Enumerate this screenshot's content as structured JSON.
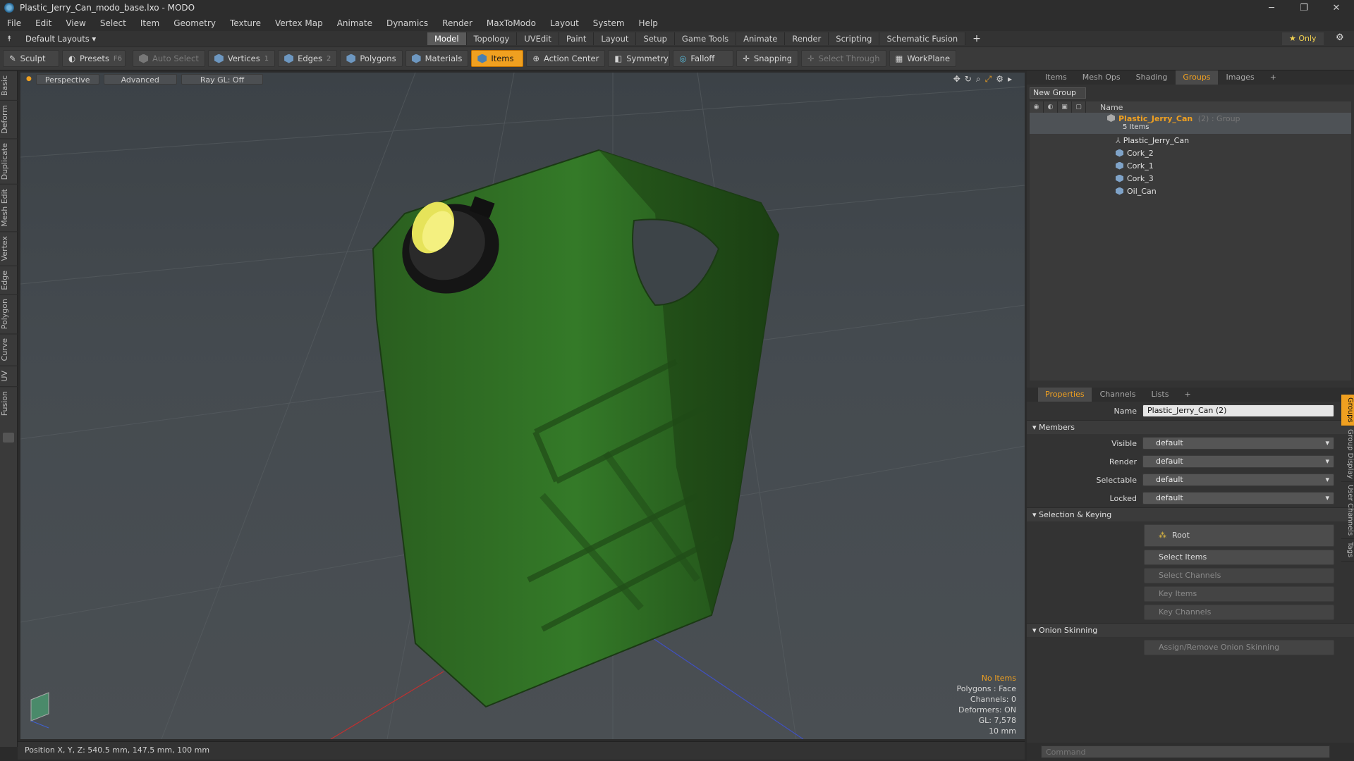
{
  "window": {
    "title": "Plastic_Jerry_Can_modo_base.lxo - MODO",
    "min": "─",
    "max": "❐",
    "close": "✕"
  },
  "menu": [
    "File",
    "Edit",
    "View",
    "Select",
    "Item",
    "Geometry",
    "Texture",
    "Vertex Map",
    "Animate",
    "Dynamics",
    "Render",
    "MaxToModo",
    "Layout",
    "System",
    "Help"
  ],
  "layout": {
    "name": "Default Layouts ▾",
    "tabs": [
      "Model",
      "Topology",
      "UVEdit",
      "Paint",
      "Layout",
      "Setup",
      "Game Tools",
      "Animate",
      "Render",
      "Scripting",
      "Schematic Fusion"
    ],
    "active": "Model",
    "plus": "+",
    "only": "★  Only"
  },
  "toolbar": {
    "sculpt": "Sculpt",
    "presets": "Presets",
    "presets_key": "F6",
    "auto_select": "Auto Select",
    "vertices": "Vertices",
    "vertices_n": "1",
    "edges": "Edges",
    "edges_n": "2",
    "polygons": "Polygons",
    "materials": "Materials",
    "items": "Items",
    "action_center": "Action Center",
    "symmetry": "Symmetry",
    "falloff": "Falloff",
    "snapping": "Snapping",
    "select_through": "Select Through",
    "workplane": "WorkPlane"
  },
  "lefttabs": [
    "Basic",
    "Deform",
    "Duplicate",
    "Mesh Edit",
    "Vertex",
    "Edge",
    "Polygon",
    "Curve",
    "UV",
    "Fusion"
  ],
  "viewport": {
    "view": "Perspective",
    "shading": "Advanced",
    "raygl": "Ray GL: Off",
    "info": {
      "no_items": "No Items",
      "polygons": "Polygons : Face",
      "channels": "Channels: 0",
      "deformers": "Deformers: ON",
      "gl": "GL: 7,578",
      "unit": "10 mm"
    }
  },
  "status": {
    "position": "Position X, Y, Z:  540.5 mm, 147.5 mm, 100 mm"
  },
  "top_panel": {
    "tabs": [
      "Items",
      "Mesh Ops",
      "Shading",
      "Groups",
      "Images"
    ],
    "active": "Groups",
    "new_group": "New Group",
    "col_name": "Name",
    "group": {
      "name": "Plastic_Jerry_Can",
      "suffix": "(2) : Group",
      "count": "5 Items"
    },
    "items": [
      "Plastic_Jerry_Can",
      "Cork_2",
      "Cork_1",
      "Cork_3",
      "Oil_Can"
    ]
  },
  "props": {
    "tabs": [
      "Properties",
      "Channels",
      "Lists"
    ],
    "active": "Properties",
    "name_label": "Name",
    "name_value": "Plastic_Jerry_Can (2)",
    "members": "Members",
    "visible_label": "Visible",
    "visible": "default",
    "render_label": "Render",
    "render": "default",
    "selectable_label": "Selectable",
    "selectable": "default",
    "locked_label": "Locked",
    "locked": "default",
    "sel_keying": "Selection & Keying",
    "root": "Root",
    "select_items": "Select Items",
    "select_channels": "Select Channels",
    "key_items": "Key Items",
    "key_channels": "Key Channels",
    "onion": "Onion Skinning",
    "assign_onion": "Assign/Remove Onion Skinning"
  },
  "side_tabs": [
    "Groups",
    "Group Display",
    "User Channels",
    "Tags"
  ],
  "command": {
    "placeholder": "Command"
  },
  "colors": {
    "accent": "#f0a020",
    "can_green": "#2e6a24"
  }
}
